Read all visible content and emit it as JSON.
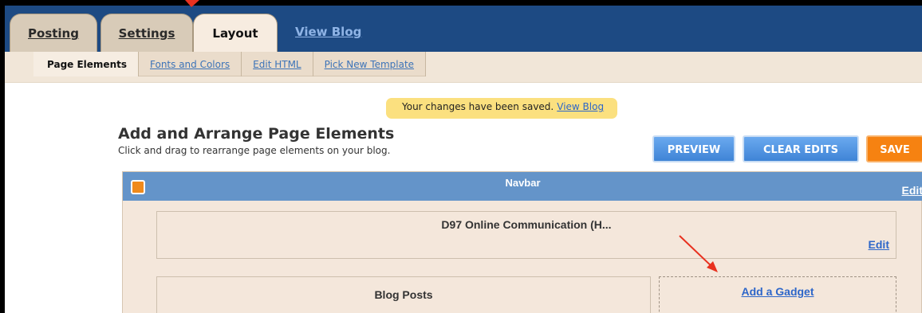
{
  "tabs": [
    {
      "label": "Posting",
      "active": false
    },
    {
      "label": "Settings",
      "active": false
    },
    {
      "label": "Layout",
      "active": true
    }
  ],
  "view_blog_tab": "View Blog",
  "subnav": [
    {
      "label": "Page Elements",
      "active": true
    },
    {
      "label": "Fonts and Colors",
      "active": false
    },
    {
      "label": "Edit HTML",
      "active": false
    },
    {
      "label": "Pick New Template",
      "active": false
    }
  ],
  "notice": {
    "text": "Your changes have been saved.",
    "link": "View Blog"
  },
  "page": {
    "title": "Add and Arrange Page Elements",
    "subtitle": "Click and drag to rearrange page elements on your blog."
  },
  "buttons": {
    "preview": "PREVIEW",
    "clear_edits": "CLEAR EDITS",
    "save": "SAVE"
  },
  "navbar": {
    "title": "Navbar",
    "edit": "Edit"
  },
  "header_widget": {
    "title": "D97 Online Communication (H...",
    "edit": "Edit"
  },
  "blog_posts": {
    "title": "Blog Posts"
  },
  "gadget": {
    "link": "Add a Gadget"
  },
  "colors": {
    "topbar": "#1d4a83",
    "accent_blue": "#2d66c9",
    "save_orange": "#f68211",
    "annotation_arrow": "#e8311f"
  }
}
